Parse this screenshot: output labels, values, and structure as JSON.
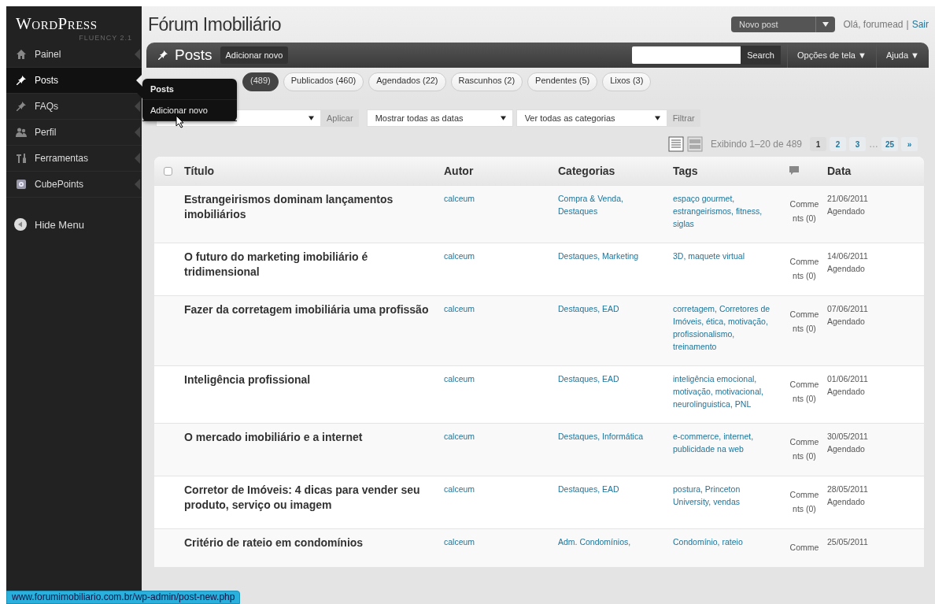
{
  "sidebar": {
    "logo": "WordPress",
    "logo_sub": "FLUENCY 2.1",
    "items": [
      {
        "label": "Painel",
        "selected": false
      },
      {
        "label": "Posts",
        "selected": true
      },
      {
        "label": "FAQs",
        "selected": false
      },
      {
        "label": "Perfil",
        "selected": false
      },
      {
        "label": "Ferramentas",
        "selected": false
      },
      {
        "label": "CubePoints",
        "selected": false
      }
    ],
    "hide_menu": "Hide Menu"
  },
  "flyout": {
    "items": [
      {
        "label": "Posts",
        "selected": true
      },
      {
        "label": "Adicionar novo",
        "selected": false
      }
    ]
  },
  "header": {
    "site_title": "Fórum Imobiliário",
    "new_post": "Novo post",
    "greeting": "Olá, forumead",
    "separator": "|",
    "logout": "Sair"
  },
  "posts_bar": {
    "title": "Posts",
    "add_new": "Adicionar novo",
    "search_button": "Search",
    "screen_options": "Opções de tela ▼",
    "help": "Ajuda ▼"
  },
  "filters": [
    {
      "label": "(489)",
      "selected": true
    },
    {
      "label": "Publicados (460)",
      "selected": false
    },
    {
      "label": "Agendados (22)",
      "selected": false
    },
    {
      "label": "Rascunhos (2)",
      "selected": false
    },
    {
      "label": "Pendentes (5)",
      "selected": false
    },
    {
      "label": "Lixos (3)",
      "selected": false
    }
  ],
  "actions": {
    "apply": "Aplicar",
    "dates": "Mostrar todas as datas",
    "categories": "Ver todas as categorias",
    "filter": "Filtrar"
  },
  "pagination": {
    "info": "Exibindo 1–20 de 489",
    "pages": [
      {
        "label": "1",
        "selected": true
      },
      {
        "label": "2",
        "selected": false
      },
      {
        "label": "3",
        "selected": false
      },
      {
        "label": "…",
        "kind": "gap"
      },
      {
        "label": "25",
        "selected": false
      },
      {
        "label": "»",
        "selected": false
      }
    ]
  },
  "table": {
    "select_all_checked": false,
    "columns": [
      "Título",
      "Autor",
      "Categorias",
      "Tags",
      "Data"
    ],
    "rows": [
      {
        "title": "Estrangeirismos dominam lançamentos imobiliários",
        "author": "calceum",
        "categories": "Compra & Venda, Destaques",
        "tags": "espaço gourmet, estrangeirismos, fitness, siglas",
        "comments": "Comments (0)",
        "date": "21/06/2011",
        "status": "Agendado"
      },
      {
        "title": "O futuro do marketing imobiliário é tridimensional",
        "author": "calceum",
        "categories": "Destaques, Marketing",
        "tags": "3D, maquete virtual",
        "comments": "Comments (0)",
        "date": "14/06/2011",
        "status": "Agendado"
      },
      {
        "title": "Fazer da corretagem imobiliária uma profissão",
        "author": "calceum",
        "categories": "Destaques, EAD",
        "tags": "corretagem, Corretores de Imóveis, ética, motivação, profissionalismo, treinamento",
        "comments": "Comments (0)",
        "date": "07/06/2011",
        "status": "Agendado"
      },
      {
        "title": "Inteligência profissional",
        "author": "calceum",
        "categories": "Destaques, EAD",
        "tags": "inteligência emocional, motivação, motivacional, neurolinguistica, PNL",
        "comments": "Comments (0)",
        "date": "01/06/2011",
        "status": "Agendado"
      },
      {
        "title": "O mercado imobiliário e a internet",
        "author": "calceum",
        "categories": "Destaques, Informática",
        "tags": "e-commerce, internet, publicidade na web",
        "comments": "Comments (0)",
        "date": "30/05/2011",
        "status": "Agendado"
      },
      {
        "title": "Corretor de Imóveis: 4 dicas para vender seu produto, serviço ou imagem",
        "author": "calceum",
        "categories": "Destaques, EAD",
        "tags": "postura, Princeton University, vendas",
        "comments": "Comments (0)",
        "date": "28/05/2011",
        "status": "Agendado"
      },
      {
        "title": "Critério de rateio em condomínios",
        "author": "calceum",
        "categories": "Adm. Condomínios,",
        "tags": "Condomínio, rateio",
        "comments": "Comme",
        "date": "25/05/2011"
      }
    ]
  },
  "status_bar": {
    "url": "www.forumimobiliario.com.br/wp-admin/post-new.php"
  }
}
